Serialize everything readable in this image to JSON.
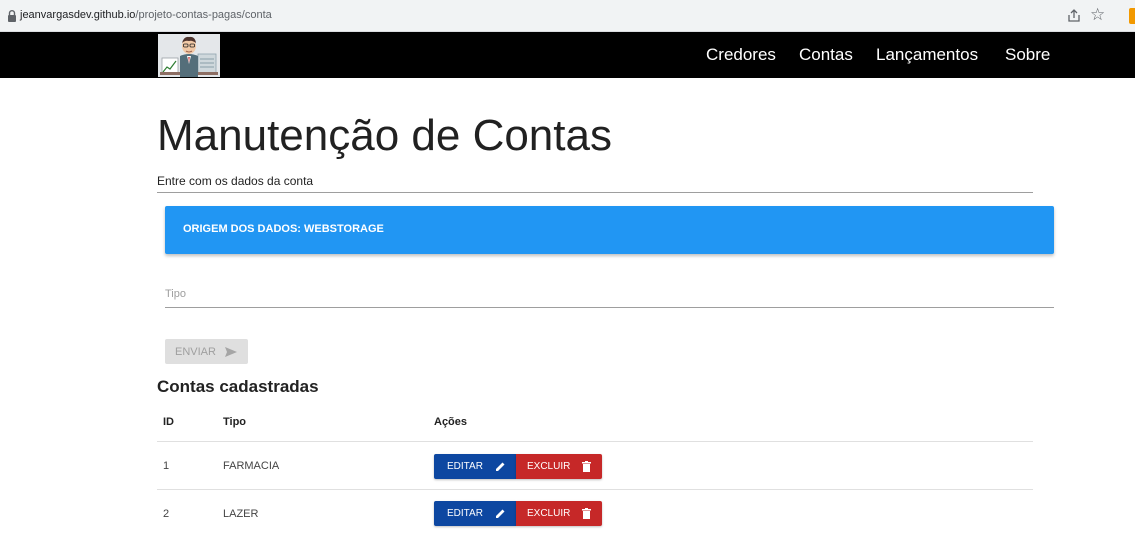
{
  "browser": {
    "url_host": "jeanvargasdev.github.io",
    "url_path": "/projeto-contas-pagas/conta",
    "icons": [
      "lock-icon",
      "share-icon",
      "star-icon"
    ]
  },
  "navbar": {
    "logo_icon": "person-at-desk-logo",
    "items": [
      {
        "label": "Credores"
      },
      {
        "label": "Contas"
      },
      {
        "label": "Lançamentos"
      },
      {
        "label": "Sobre"
      }
    ]
  },
  "main": {
    "title": "Manutenção de Contas",
    "subtitle": "Entre com os dados da conta",
    "banner": {
      "text": "ORIGEM DOS DADOS: WEBSTORAGE",
      "color": "#2196f3"
    },
    "form": {
      "tipo_placeholder": "Tipo",
      "tipo_value": "",
      "submit_label": "ENVIAR",
      "submit_icon": "send-icon",
      "submit_disabled": true
    },
    "list": {
      "title": "Contas cadastradas",
      "columns": [
        "ID",
        "Tipo",
        "Ações"
      ],
      "rows": [
        {
          "id": "1",
          "tipo": "FARMACIA"
        },
        {
          "id": "2",
          "tipo": "LAZER"
        }
      ],
      "actions": {
        "edit_label": "EDITAR",
        "edit_icon": "pencil-icon",
        "edit_color": "#0d47a1",
        "delete_label": "EXCLUIR",
        "delete_icon": "trash-icon",
        "delete_color": "#c62828"
      }
    }
  }
}
